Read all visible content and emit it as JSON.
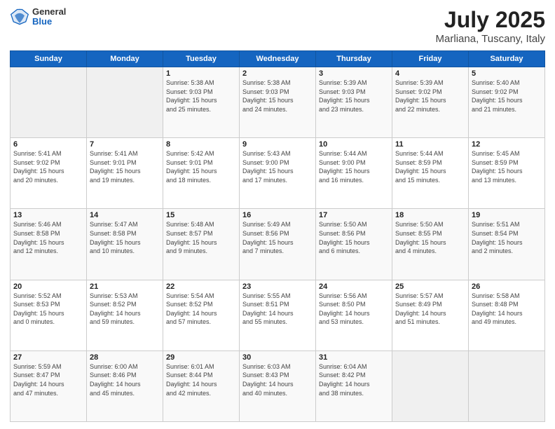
{
  "header": {
    "logo_general": "General",
    "logo_blue": "Blue",
    "title": "July 2025",
    "subtitle": "Marliana, Tuscany, Italy"
  },
  "weekdays": [
    "Sunday",
    "Monday",
    "Tuesday",
    "Wednesday",
    "Thursday",
    "Friday",
    "Saturday"
  ],
  "weeks": [
    [
      {
        "day": "",
        "info": ""
      },
      {
        "day": "",
        "info": ""
      },
      {
        "day": "1",
        "info": "Sunrise: 5:38 AM\nSunset: 9:03 PM\nDaylight: 15 hours\nand 25 minutes."
      },
      {
        "day": "2",
        "info": "Sunrise: 5:38 AM\nSunset: 9:03 PM\nDaylight: 15 hours\nand 24 minutes."
      },
      {
        "day": "3",
        "info": "Sunrise: 5:39 AM\nSunset: 9:03 PM\nDaylight: 15 hours\nand 23 minutes."
      },
      {
        "day": "4",
        "info": "Sunrise: 5:39 AM\nSunset: 9:02 PM\nDaylight: 15 hours\nand 22 minutes."
      },
      {
        "day": "5",
        "info": "Sunrise: 5:40 AM\nSunset: 9:02 PM\nDaylight: 15 hours\nand 21 minutes."
      }
    ],
    [
      {
        "day": "6",
        "info": "Sunrise: 5:41 AM\nSunset: 9:02 PM\nDaylight: 15 hours\nand 20 minutes."
      },
      {
        "day": "7",
        "info": "Sunrise: 5:41 AM\nSunset: 9:01 PM\nDaylight: 15 hours\nand 19 minutes."
      },
      {
        "day": "8",
        "info": "Sunrise: 5:42 AM\nSunset: 9:01 PM\nDaylight: 15 hours\nand 18 minutes."
      },
      {
        "day": "9",
        "info": "Sunrise: 5:43 AM\nSunset: 9:00 PM\nDaylight: 15 hours\nand 17 minutes."
      },
      {
        "day": "10",
        "info": "Sunrise: 5:44 AM\nSunset: 9:00 PM\nDaylight: 15 hours\nand 16 minutes."
      },
      {
        "day": "11",
        "info": "Sunrise: 5:44 AM\nSunset: 8:59 PM\nDaylight: 15 hours\nand 15 minutes."
      },
      {
        "day": "12",
        "info": "Sunrise: 5:45 AM\nSunset: 8:59 PM\nDaylight: 15 hours\nand 13 minutes."
      }
    ],
    [
      {
        "day": "13",
        "info": "Sunrise: 5:46 AM\nSunset: 8:58 PM\nDaylight: 15 hours\nand 12 minutes."
      },
      {
        "day": "14",
        "info": "Sunrise: 5:47 AM\nSunset: 8:58 PM\nDaylight: 15 hours\nand 10 minutes."
      },
      {
        "day": "15",
        "info": "Sunrise: 5:48 AM\nSunset: 8:57 PM\nDaylight: 15 hours\nand 9 minutes."
      },
      {
        "day": "16",
        "info": "Sunrise: 5:49 AM\nSunset: 8:56 PM\nDaylight: 15 hours\nand 7 minutes."
      },
      {
        "day": "17",
        "info": "Sunrise: 5:50 AM\nSunset: 8:56 PM\nDaylight: 15 hours\nand 6 minutes."
      },
      {
        "day": "18",
        "info": "Sunrise: 5:50 AM\nSunset: 8:55 PM\nDaylight: 15 hours\nand 4 minutes."
      },
      {
        "day": "19",
        "info": "Sunrise: 5:51 AM\nSunset: 8:54 PM\nDaylight: 15 hours\nand 2 minutes."
      }
    ],
    [
      {
        "day": "20",
        "info": "Sunrise: 5:52 AM\nSunset: 8:53 PM\nDaylight: 15 hours\nand 0 minutes."
      },
      {
        "day": "21",
        "info": "Sunrise: 5:53 AM\nSunset: 8:52 PM\nDaylight: 14 hours\nand 59 minutes."
      },
      {
        "day": "22",
        "info": "Sunrise: 5:54 AM\nSunset: 8:52 PM\nDaylight: 14 hours\nand 57 minutes."
      },
      {
        "day": "23",
        "info": "Sunrise: 5:55 AM\nSunset: 8:51 PM\nDaylight: 14 hours\nand 55 minutes."
      },
      {
        "day": "24",
        "info": "Sunrise: 5:56 AM\nSunset: 8:50 PM\nDaylight: 14 hours\nand 53 minutes."
      },
      {
        "day": "25",
        "info": "Sunrise: 5:57 AM\nSunset: 8:49 PM\nDaylight: 14 hours\nand 51 minutes."
      },
      {
        "day": "26",
        "info": "Sunrise: 5:58 AM\nSunset: 8:48 PM\nDaylight: 14 hours\nand 49 minutes."
      }
    ],
    [
      {
        "day": "27",
        "info": "Sunrise: 5:59 AM\nSunset: 8:47 PM\nDaylight: 14 hours\nand 47 minutes."
      },
      {
        "day": "28",
        "info": "Sunrise: 6:00 AM\nSunset: 8:46 PM\nDaylight: 14 hours\nand 45 minutes."
      },
      {
        "day": "29",
        "info": "Sunrise: 6:01 AM\nSunset: 8:44 PM\nDaylight: 14 hours\nand 42 minutes."
      },
      {
        "day": "30",
        "info": "Sunrise: 6:03 AM\nSunset: 8:43 PM\nDaylight: 14 hours\nand 40 minutes."
      },
      {
        "day": "31",
        "info": "Sunrise: 6:04 AM\nSunset: 8:42 PM\nDaylight: 14 hours\nand 38 minutes."
      },
      {
        "day": "",
        "info": ""
      },
      {
        "day": "",
        "info": ""
      }
    ]
  ]
}
